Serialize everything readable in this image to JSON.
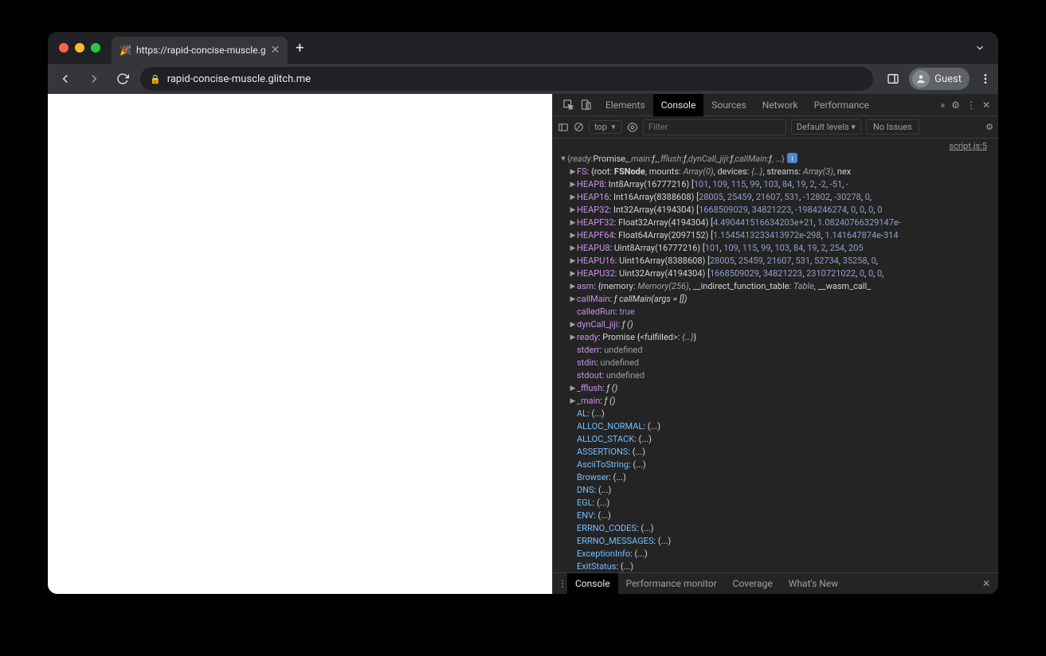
{
  "tab": {
    "title": "https://rapid-concise-muscle.g",
    "favicon": "🎉"
  },
  "url": "rapid-concise-muscle.glitch.me",
  "guest_label": "Guest",
  "devtools": {
    "tabs": [
      "Elements",
      "Console",
      "Sources",
      "Network",
      "Performance"
    ],
    "active_tab": "Console",
    "context": "top",
    "filter_placeholder": "Filter",
    "levels": "Default levels ▾",
    "issues": "No Issues",
    "source_link": "script.js:5",
    "drawer_tabs": [
      "Console",
      "Performance monitor",
      "Coverage",
      "What's New"
    ],
    "drawer_active": "Console",
    "summary_parts": {
      "p1": "{",
      "k1": "ready",
      "c1": ": ",
      "v1": "Promise",
      "c2": ", ",
      "k2": "_main",
      "c3": ": ",
      "v2": "ƒ",
      "c4": ", ",
      "k3": "_fflush",
      "c5": ": ",
      "v3": "ƒ",
      "c6": ", ",
      "k4": "dynCall_jiji",
      "c7": ": ",
      "v4": "ƒ",
      "c8": ", ",
      "k5": "callMain",
      "c9": ": ",
      "v5": "ƒ",
      "c10": ", …}"
    },
    "props": [
      {
        "arrow": "right",
        "key": "FS",
        "raw": ": {root: <b>FSNode</b>, mounts: <i>Array(0)</i>, devices: <i>{…}</i>, streams: <i>Array(3)</i>, nex"
      },
      {
        "arrow": "right",
        "key": "HEAP8",
        "raw": ": Int8Array(16777216) [<n>101</n>, <n>109</n>, <n>115</n>, <n>99</n>, <n>103</n>, <n>84</n>, <n>19</n>, <n>2</n>, <n>-2</n>, <n>-51</n>, <n>-</n>"
      },
      {
        "arrow": "right",
        "key": "HEAP16",
        "raw": ": Int16Array(8388608) [<n>28005</n>, <n>25459</n>, <n>21607</n>, <n>531</n>, <n>-12802</n>, <n>-30278</n>, <n>0</n>,"
      },
      {
        "arrow": "right",
        "key": "HEAP32",
        "raw": ": Int32Array(4194304) [<n>1668509029</n>, <n>34821223</n>, <n>-1984246274</n>, <n>0</n>, <n>0</n>, <n>0</n>, <n>0</n>"
      },
      {
        "arrow": "right",
        "key": "HEAPF32",
        "raw": ": Float32Array(4194304) [<n>4.490441516634203e+21</n>, <n>1.08240766329147e-</n>"
      },
      {
        "arrow": "right",
        "key": "HEAPF64",
        "raw": ": Float64Array(2097152) [<n>1.1545413233413972e-298</n>, <n>1.141647874e-314</n>"
      },
      {
        "arrow": "right",
        "key": "HEAPU8",
        "raw": ": Uint8Array(16777216) [<n>101</n>, <n>109</n>, <n>115</n>, <n>99</n>, <n>103</n>, <n>84</n>, <n>19</n>, <n>2</n>, <n>254</n>, <n>205</n>"
      },
      {
        "arrow": "right",
        "key": "HEAPU16",
        "raw": ": Uint16Array(8388608) [<n>28005</n>, <n>25459</n>, <n>21607</n>, <n>531</n>, <n>52734</n>, <n>35258</n>, <n>0</n>,"
      },
      {
        "arrow": "right",
        "key": "HEAPU32",
        "raw": ": Uint32Array(4194304) [<n>1668509029</n>, <n>34821223</n>, <n>2310721022</n>, <n>0</n>, <n>0</n>, <n>0</n>,"
      },
      {
        "arrow": "right",
        "key": "asm",
        "raw": ": {memory: <i>Memory(256)</i>, __indirect_function_table: <i>Table</i>, __wasm_call_"
      },
      {
        "arrow": "right",
        "key": "callMain",
        "raw": ": <f>ƒ callMain(args = [])</f>"
      },
      {
        "arrow": "none",
        "key": "calledRun",
        "raw": ": <bool>true</bool>"
      },
      {
        "arrow": "right",
        "key": "dynCall_jiji",
        "raw": ": <f>ƒ ()</f>"
      },
      {
        "arrow": "right",
        "key": "ready",
        "raw": ": Promise {&lt;fulfilled&gt;: <i>{…}</i>}"
      },
      {
        "arrow": "none",
        "key": "stderr",
        "raw": ": <u>undefined</u>"
      },
      {
        "arrow": "none",
        "key": "stdin",
        "raw": ": <u>undefined</u>"
      },
      {
        "arrow": "none",
        "key": "stdout",
        "raw": ": <u>undefined</u>"
      },
      {
        "arrow": "right",
        "key": "_fflush",
        "raw": ": <f>ƒ ()</f>"
      },
      {
        "arrow": "right",
        "key": "_main",
        "raw": ": <f>ƒ ()</f>"
      },
      {
        "arrow": "none",
        "pale": true,
        "key": "AL",
        "raw": ": (...)"
      },
      {
        "arrow": "none",
        "pale": true,
        "key": "ALLOC_NORMAL",
        "raw": ": (...)"
      },
      {
        "arrow": "none",
        "pale": true,
        "key": "ALLOC_STACK",
        "raw": ": (...)"
      },
      {
        "arrow": "none",
        "pale": true,
        "key": "ASSERTIONS",
        "raw": ": (...)"
      },
      {
        "arrow": "none",
        "pale": true,
        "key": "AsciiToString",
        "raw": ": (...)"
      },
      {
        "arrow": "none",
        "pale": true,
        "key": "Browser",
        "raw": ": (...)"
      },
      {
        "arrow": "none",
        "pale": true,
        "key": "DNS",
        "raw": ": (...)"
      },
      {
        "arrow": "none",
        "pale": true,
        "key": "EGL",
        "raw": ": (...)"
      },
      {
        "arrow": "none",
        "pale": true,
        "key": "ENV",
        "raw": ": (...)"
      },
      {
        "arrow": "none",
        "pale": true,
        "key": "ERRNO_CODES",
        "raw": ": (...)"
      },
      {
        "arrow": "none",
        "pale": true,
        "key": "ERRNO_MESSAGES",
        "raw": ": (...)"
      },
      {
        "arrow": "none",
        "pale": true,
        "key": "ExceptionInfo",
        "raw": ": (...)"
      },
      {
        "arrow": "none",
        "pale": true,
        "key": "ExitStatus",
        "raw": ": (...)"
      }
    ]
  }
}
